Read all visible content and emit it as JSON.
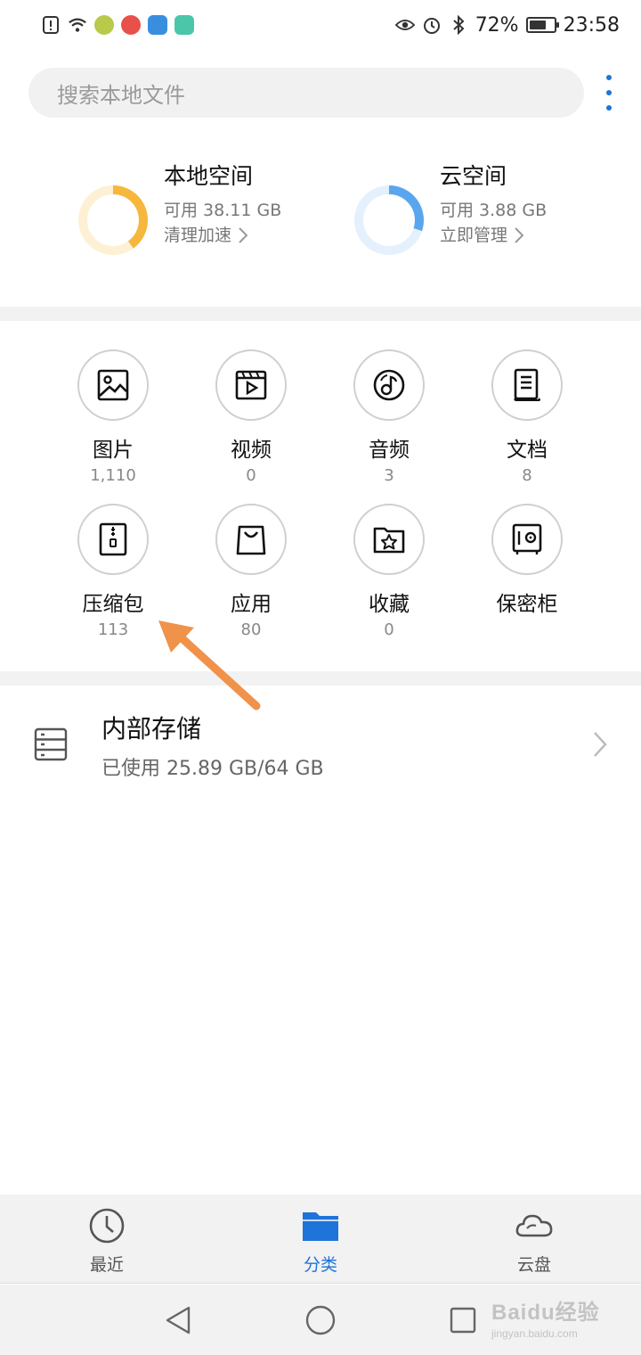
{
  "status_bar": {
    "battery": "72%",
    "time": "23:58",
    "battery_level": 0.72
  },
  "search": {
    "placeholder": "搜索本地文件"
  },
  "storage": {
    "local": {
      "title": "本地空间",
      "available": "可用 38.11 GB",
      "action": "清理加速",
      "used_fraction": 0.4
    },
    "cloud": {
      "title": "云空间",
      "available": "可用 3.88 GB",
      "action": "立即管理",
      "used_fraction": 0.3
    }
  },
  "categories": [
    {
      "label": "图片",
      "count": "1,110",
      "icon": "image-icon"
    },
    {
      "label": "视频",
      "count": "0",
      "icon": "video-icon"
    },
    {
      "label": "音频",
      "count": "3",
      "icon": "audio-icon"
    },
    {
      "label": "文档",
      "count": "8",
      "icon": "document-icon"
    },
    {
      "label": "压缩包",
      "count": "113",
      "icon": "archive-icon"
    },
    {
      "label": "应用",
      "count": "80",
      "icon": "app-bag-icon"
    },
    {
      "label": "收藏",
      "count": "0",
      "icon": "favorite-folder-icon"
    },
    {
      "label": "保密柜",
      "count": "",
      "icon": "safe-icon"
    }
  ],
  "internal_storage": {
    "title": "内部存储",
    "usage": "已使用 25.89 GB/64 GB"
  },
  "tabs": [
    {
      "label": "最近",
      "icon": "clock-icon",
      "active": false
    },
    {
      "label": "分类",
      "icon": "folder-icon",
      "active": true
    },
    {
      "label": "云盘",
      "icon": "cloud-icon",
      "active": false
    }
  ],
  "colors": {
    "accent": "#1e74d8",
    "local_ring": "#f6b73c",
    "cloud_ring": "#5aa6ee",
    "annotation_arrow": "#f0924a"
  },
  "watermark": {
    "main": "Baidu经验",
    "sub": "jingyan.baidu.com"
  }
}
